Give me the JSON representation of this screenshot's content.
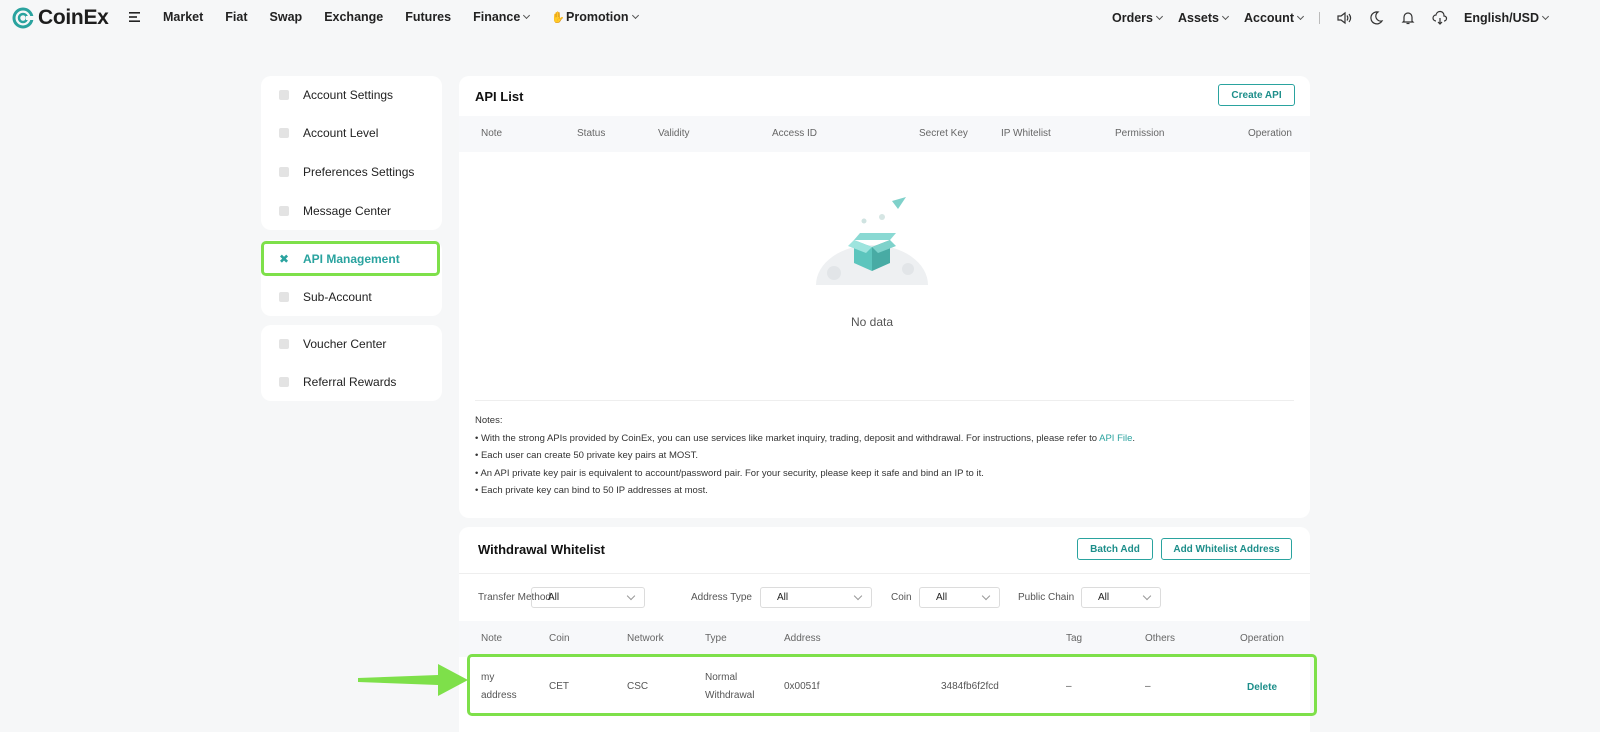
{
  "nav": {
    "logo": "CoinEx",
    "left_items": [
      "Market",
      "Fiat",
      "Swap",
      "Exchange",
      "Futures"
    ],
    "finance": "Finance",
    "promotion": "Promotion",
    "right_items": [
      "Orders",
      "Assets",
      "Account"
    ],
    "language": "English/USD"
  },
  "sidebar": {
    "group1": [
      "Account Settings",
      "Account Level",
      "Preferences Settings",
      "Message Center"
    ],
    "group2": [
      "API Management",
      "Sub-Account"
    ],
    "group3": [
      "Voucher Center",
      "Referral Rewards"
    ]
  },
  "api": {
    "title": "API List",
    "create_button": "Create API",
    "columns": [
      "Note",
      "Status",
      "Validity",
      "Access ID",
      "Secret Key",
      "IP Whitelist",
      "Permission",
      "Operation"
    ],
    "empty_text": "No data",
    "notes_title": "Notes:",
    "note1_prefix": "• With the strong APIs provided by CoinEx, you can use services like market inquiry, trading, deposit and withdrawal. For instructions, please refer to ",
    "note1_link": "API File",
    "note1_suffix": ".",
    "note2": "• Each user can create 50 private key pairs at MOST.",
    "note3": "• An API private key pair is equivalent to account/password pair. For your security, please keep it safe and bind an IP to it.",
    "note4": "• Each private key can bind to 50 IP addresses at most."
  },
  "whitelist": {
    "title": "Withdrawal Whitelist",
    "batch_add": "Batch Add",
    "add_address": "Add Whitelist Address",
    "filters": {
      "transfer_method_label": "Transfer Method",
      "transfer_method_value": "All",
      "address_type_label": "Address Type",
      "address_type_value": "All",
      "coin_label": "Coin",
      "coin_value": "All",
      "public_chain_label": "Public Chain",
      "public_chain_value": "All"
    },
    "columns": [
      "Note",
      "Coin",
      "Network",
      "Type",
      "Address",
      "Tag",
      "Others",
      "Operation"
    ],
    "row": {
      "note_line1": "my",
      "note_line2": "address",
      "coin": "CET",
      "network": "CSC",
      "type_line1": "Normal",
      "type_line2": "Withdrawal",
      "address_start": "0x0051f",
      "address_end": "3484fb6f2fcd",
      "tag": "–",
      "others": "–",
      "operation": "Delete"
    }
  },
  "colors": {
    "brand": "#2aa39f",
    "highlight": "#7ee04a"
  }
}
